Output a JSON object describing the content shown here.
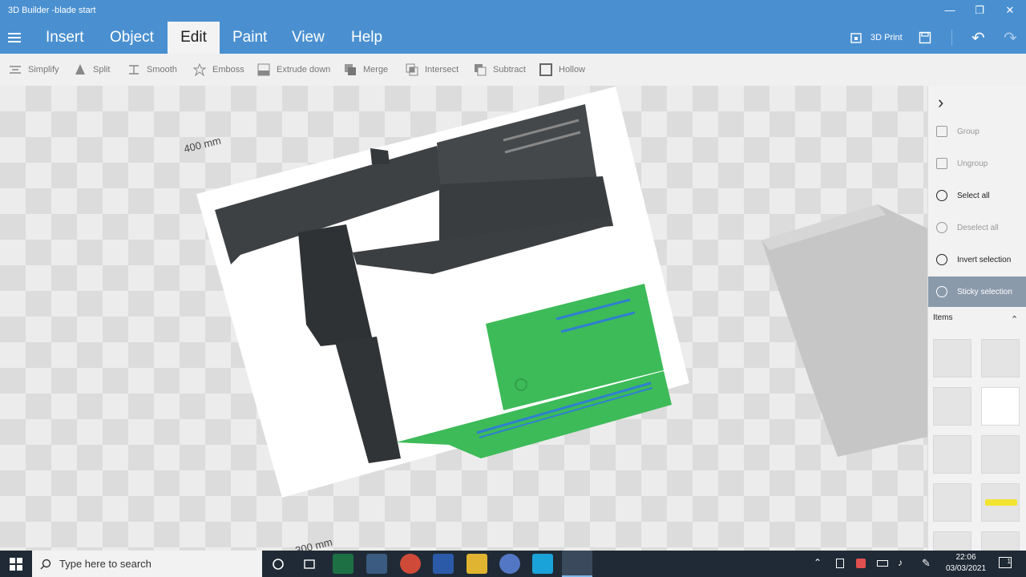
{
  "window": {
    "title": "3D Builder -blade start",
    "minimize_glyph": "—",
    "maximize_glyph": "❐",
    "close_glyph": "✕"
  },
  "menu": {
    "items": [
      {
        "label": "Insert"
      },
      {
        "label": "Object"
      },
      {
        "label": "Edit",
        "active": true
      },
      {
        "label": "Paint"
      },
      {
        "label": "View"
      },
      {
        "label": "Help"
      }
    ],
    "print_label": "3D Print",
    "undo_glyph": "↶",
    "redo_glyph": "↷"
  },
  "toolbar": {
    "tools": [
      {
        "label": "Simplify",
        "icon": "simplify-icon"
      },
      {
        "label": "Split",
        "icon": "split-icon"
      },
      {
        "label": "Smooth",
        "icon": "smooth-icon"
      },
      {
        "label": "Emboss",
        "icon": "star-icon"
      },
      {
        "label": "Extrude down",
        "icon": "extrude-icon"
      },
      {
        "label": "Merge",
        "icon": "merge-icon"
      },
      {
        "label": "Intersect",
        "icon": "intersect-icon"
      },
      {
        "label": "Subtract",
        "icon": "subtract-icon"
      },
      {
        "label": "Hollow",
        "icon": "hollow-icon"
      }
    ]
  },
  "canvas": {
    "dim_top": "400 mm",
    "dim_bottom": "300 mm",
    "colors": {
      "green": "#3dbb58",
      "blue": "#2f7fd0",
      "plate": "#ffffff",
      "gun": "#3f4143"
    }
  },
  "panel": {
    "collapse_glyph": "›",
    "actions": [
      {
        "label": "Group",
        "enabled": false
      },
      {
        "label": "Ungroup",
        "enabled": false
      },
      {
        "label": "Select all",
        "enabled": true
      },
      {
        "label": "Deselect all",
        "enabled": false
      },
      {
        "label": "Invert selection",
        "enabled": true
      },
      {
        "label": "Sticky selection",
        "enabled": true,
        "active": true
      }
    ],
    "items_header": "Items",
    "items_toggle_glyph": "⌃"
  },
  "taskbar": {
    "search_placeholder": "Type here to search",
    "time": "22:06",
    "date": "03/03/2021",
    "notification_count": "1"
  }
}
